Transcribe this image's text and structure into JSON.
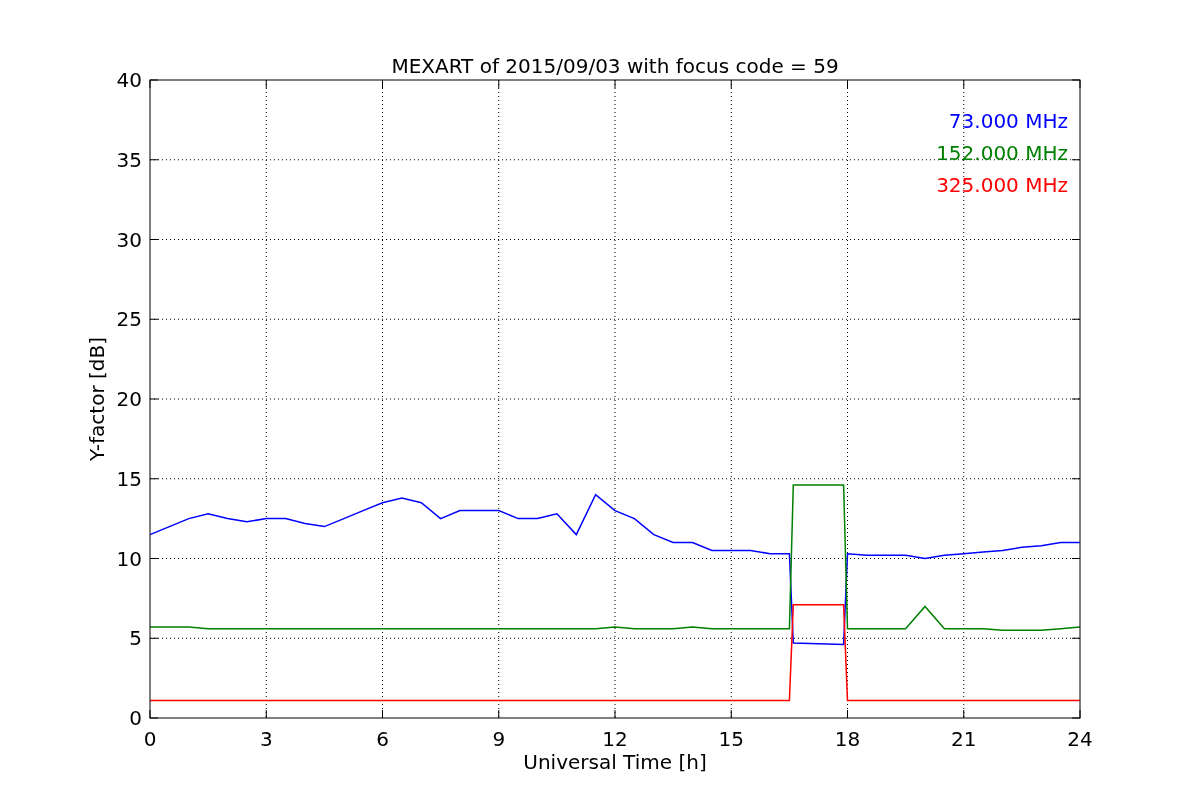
{
  "figure": {
    "chart_data": {
      "type": "line",
      "grid": true,
      "title": "MEXART of 2015/09/03 with focus code = 59",
      "xlabel": "Universal Time [h]",
      "ylabel": "Y-factor [dB]",
      "xlim": [
        0,
        24
      ],
      "ylim": [
        0,
        40
      ],
      "xticks": [
        0,
        3,
        6,
        9,
        12,
        15,
        18,
        21,
        24
      ],
      "yticks": [
        0,
        5,
        10,
        15,
        20,
        25,
        30,
        35,
        40
      ],
      "x": [
        0,
        0.5,
        1,
        1.5,
        2,
        2.5,
        3,
        3.5,
        4,
        4.5,
        5,
        5.5,
        6,
        6.5,
        7,
        7.5,
        8,
        8.5,
        9,
        9.5,
        10,
        10.5,
        11,
        11.5,
        12,
        12.5,
        13,
        13.5,
        14,
        14.5,
        15,
        15.5,
        16,
        16.5,
        16.6,
        17.9,
        18,
        18.5,
        19,
        19.5,
        20,
        20.5,
        21,
        21.5,
        22,
        22.5,
        23,
        23.5,
        24
      ],
      "series": [
        {
          "name": "73.000 MHz",
          "color": "#0000ff",
          "values": [
            11.5,
            12,
            12.5,
            12.8,
            12.5,
            12.3,
            12.5,
            12.5,
            12.2,
            12,
            12.5,
            13,
            13.5,
            13.8,
            13.5,
            12.5,
            13,
            13,
            13,
            12.5,
            12.5,
            12.8,
            11.5,
            14,
            13,
            12.5,
            11.5,
            11,
            11,
            10.5,
            10.5,
            10.5,
            10.3,
            10.3,
            4.7,
            4.6,
            10.3,
            10.2,
            10.2,
            10.2,
            10,
            10.2,
            10.3,
            10.4,
            10.5,
            10.7,
            10.8,
            11,
            11
          ]
        },
        {
          "name": "152.000 MHz",
          "color": "#008000",
          "values": [
            5.7,
            5.7,
            5.7,
            5.6,
            5.6,
            5.6,
            5.6,
            5.6,
            5.6,
            5.6,
            5.6,
            5.6,
            5.6,
            5.6,
            5.6,
            5.6,
            5.6,
            5.6,
            5.6,
            5.6,
            5.6,
            5.6,
            5.6,
            5.6,
            5.7,
            5.6,
            5.6,
            5.6,
            5.7,
            5.6,
            5.6,
            5.6,
            5.6,
            5.6,
            14.6,
            14.6,
            5.6,
            5.6,
            5.6,
            5.6,
            7,
            5.6,
            5.6,
            5.6,
            5.5,
            5.5,
            5.5,
            5.6,
            5.7
          ]
        },
        {
          "name": "325.000 MHz",
          "color": "#ff0000",
          "values": [
            1.1,
            1.1,
            1.1,
            1.1,
            1.1,
            1.1,
            1.1,
            1.1,
            1.1,
            1.1,
            1.1,
            1.1,
            1.1,
            1.1,
            1.1,
            1.1,
            1.1,
            1.1,
            1.1,
            1.1,
            1.1,
            1.1,
            1.1,
            1.1,
            1.1,
            1.1,
            1.1,
            1.1,
            1.1,
            1.1,
            1.1,
            1.1,
            1.1,
            1.1,
            7.1,
            7.1,
            1.1,
            1.1,
            1.1,
            1.1,
            1.1,
            1.1,
            1.1,
            1.1,
            1.1,
            1.1,
            1.1,
            1.1,
            1.1
          ]
        }
      ]
    }
  }
}
